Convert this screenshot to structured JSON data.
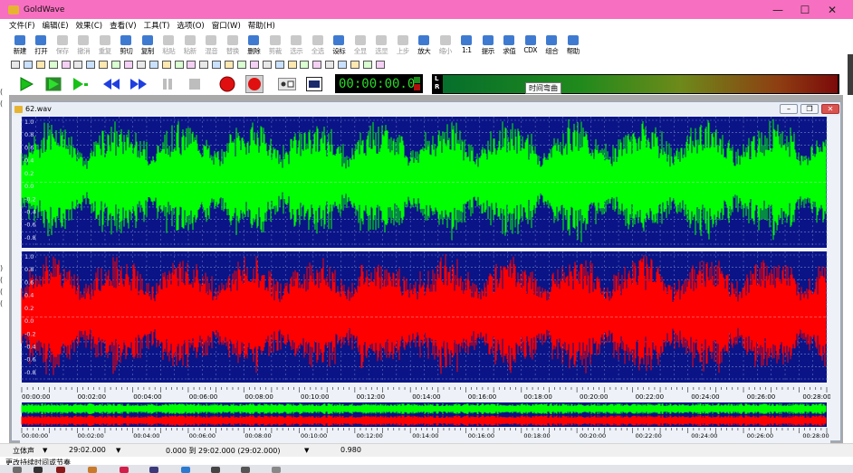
{
  "window": {
    "title": "GoldWave",
    "min": "—",
    "max": "☐",
    "close": "✕"
  },
  "menu": [
    "文件(F)",
    "编辑(E)",
    "效果(C)",
    "查看(V)",
    "工具(T)",
    "选项(O)",
    "窗口(W)",
    "帮助(H)"
  ],
  "toolbar_main": [
    {
      "label": "新建",
      "name": "new",
      "enabled": true
    },
    {
      "label": "打开",
      "name": "open",
      "enabled": true
    },
    {
      "label": "保存",
      "name": "save",
      "enabled": false
    },
    {
      "label": "撤消",
      "name": "undo",
      "enabled": false
    },
    {
      "label": "重复",
      "name": "redo",
      "enabled": false
    },
    {
      "label": "剪切",
      "name": "cut",
      "enabled": true
    },
    {
      "label": "复制",
      "name": "copy",
      "enabled": true
    },
    {
      "label": "粘贴",
      "name": "paste",
      "enabled": false
    },
    {
      "label": "粘新",
      "name": "paste-new",
      "enabled": false
    },
    {
      "label": "混音",
      "name": "mix",
      "enabled": false
    },
    {
      "label": "替换",
      "name": "replace",
      "enabled": false
    },
    {
      "label": "删除",
      "name": "delete",
      "enabled": true
    },
    {
      "label": "剪裁",
      "name": "trim",
      "enabled": false
    },
    {
      "label": "选示",
      "name": "show-selection",
      "enabled": false
    },
    {
      "label": "全选",
      "name": "select-all",
      "enabled": false
    },
    {
      "label": "设标",
      "name": "set-marker",
      "enabled": true
    },
    {
      "label": "全显",
      "name": "view-all",
      "enabled": false
    },
    {
      "label": "选显",
      "name": "view-selection",
      "enabled": false
    },
    {
      "label": "上步",
      "name": "previous",
      "enabled": false
    },
    {
      "label": "放大",
      "name": "zoom-in",
      "enabled": true
    },
    {
      "label": "缩小",
      "name": "zoom-out",
      "enabled": false
    },
    {
      "label": "1:1",
      "name": "zoom-1-1",
      "enabled": true
    },
    {
      "label": "提示",
      "name": "cue",
      "enabled": true
    },
    {
      "label": "求值",
      "name": "evaluate",
      "enabled": true
    },
    {
      "label": "CDX",
      "name": "cd-reader",
      "enabled": true
    },
    {
      "label": "组合",
      "name": "combine",
      "enabled": true
    },
    {
      "label": "帮助",
      "name": "help",
      "enabled": true
    }
  ],
  "counter": "00:00:00.0",
  "meter": {
    "left": "L",
    "right": "R"
  },
  "tooltip": "时间弯曲",
  "document": {
    "title": "62.wav",
    "min": "–",
    "restore": "❐",
    "close": "✕"
  },
  "wave_left_labels": [
    "1.0",
    "0.8",
    "0.6",
    "0.4",
    "0.2",
    "0.0",
    "-0.2",
    "-0.4",
    "-0.6",
    "-0.8"
  ],
  "wave_right_labels": [
    "1.0",
    "0.8",
    "0.6",
    "0.4",
    "0.2",
    "0.0",
    "-0.2",
    "-0.4",
    "-0.6",
    "-0.8"
  ],
  "timeline": [
    "00:00:00",
    "00:02:00",
    "00:04:00",
    "00:06:00",
    "00:08:00",
    "00:10:00",
    "00:12:00",
    "00:14:00",
    "00:16:00",
    "00:18:00",
    "00:20:00",
    "00:22:00",
    "00:24:00",
    "00:26:00",
    "00:28:00"
  ],
  "status": {
    "channel": "立体声",
    "length": "29:02.000",
    "selection": "0.000 到 29:02.000 (29:02.000)",
    "zoom": "0.980"
  },
  "hint": "更改持续时间或节奏",
  "colors": {
    "left_wave": "#00ff00",
    "right_wave": "#ff0000",
    "wave_bg": "#0b1487",
    "grid": "#6f86c7"
  }
}
